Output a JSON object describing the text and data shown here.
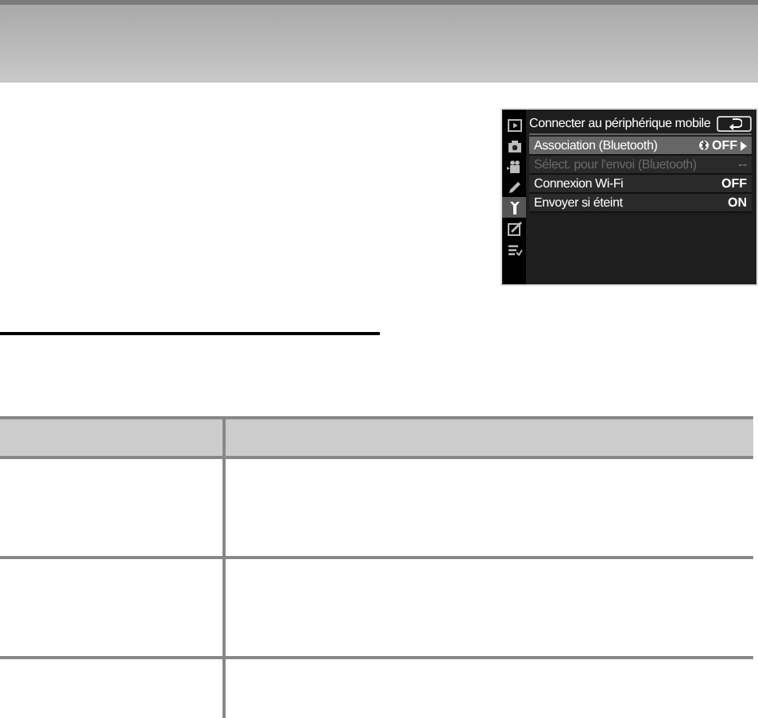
{
  "camera_menu": {
    "title": "Connecter au périphérique mobile",
    "sidebar_tabs": [
      {
        "kind": "playback",
        "selected": false
      },
      {
        "kind": "photo",
        "selected": false
      },
      {
        "kind": "movie",
        "selected": false
      },
      {
        "kind": "custom",
        "selected": false
      },
      {
        "kind": "setup",
        "selected": true
      },
      {
        "kind": "retouch",
        "selected": false
      },
      {
        "kind": "mymenu",
        "selected": false
      }
    ],
    "items": [
      {
        "kind": "bluetooth",
        "label": "Association (Bluetooth)",
        "value": "OFF",
        "selected": true,
        "disabled": false
      },
      {
        "kind": "value",
        "label": "Sélect. pour l'envoi (Bluetooth)",
        "value": "--",
        "selected": false,
        "disabled": true
      },
      {
        "kind": "value",
        "label": "Connexion Wi-Fi",
        "value": "OFF",
        "selected": false,
        "disabled": false
      },
      {
        "kind": "value",
        "label": "Envoyer si éteint",
        "value": "ON",
        "selected": false,
        "disabled": false
      }
    ]
  }
}
